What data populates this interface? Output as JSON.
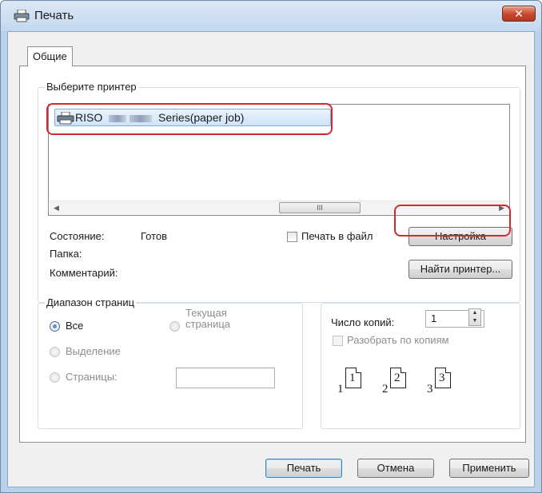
{
  "window": {
    "title": "Печать",
    "close_glyph": "✕"
  },
  "tabs": [
    {
      "label": "Общие"
    }
  ],
  "printer_group": {
    "legend": "Выберите принтер",
    "selected_printer": "RISO Series(paper job)",
    "selected_printer_prefix": "RISO",
    "selected_printer_suffix": "Series(paper job)",
    "status_label": "Состояние:",
    "status_value": "Готов",
    "folder_label": "Папка:",
    "comment_label": "Комментарий:",
    "print_to_file_label": "Печать в файл",
    "print_to_file_checked": false,
    "settings_button": "Настройка",
    "find_printer_button": "Найти принтер...",
    "scroll_thumb_glyph": "III"
  },
  "page_range": {
    "legend": "Диапазон страниц",
    "all_label": "Все",
    "selection_label": "Выделение",
    "pages_label": "Страницы:",
    "current_page_line1": "Текущая",
    "current_page_line2": "страница",
    "selected_option": "Все",
    "pages_value": ""
  },
  "copies": {
    "count_label": "Число копий:",
    "count_value": "1",
    "collate_label": "Разобрать по копиям",
    "collate_checked": false,
    "collate_pages": [
      "1",
      "1",
      "2",
      "2",
      "3",
      "3"
    ]
  },
  "footer": {
    "print_button": "Печать",
    "cancel_button": "Отмена",
    "apply_button": "Применить"
  },
  "colors": {
    "highlight": "#d9262f",
    "selection": "#cde4fb",
    "close_button": "#c8472c"
  },
  "icons": {
    "title": "printer-icon",
    "printer_item": "printer-icon",
    "close": "close-icon"
  }
}
